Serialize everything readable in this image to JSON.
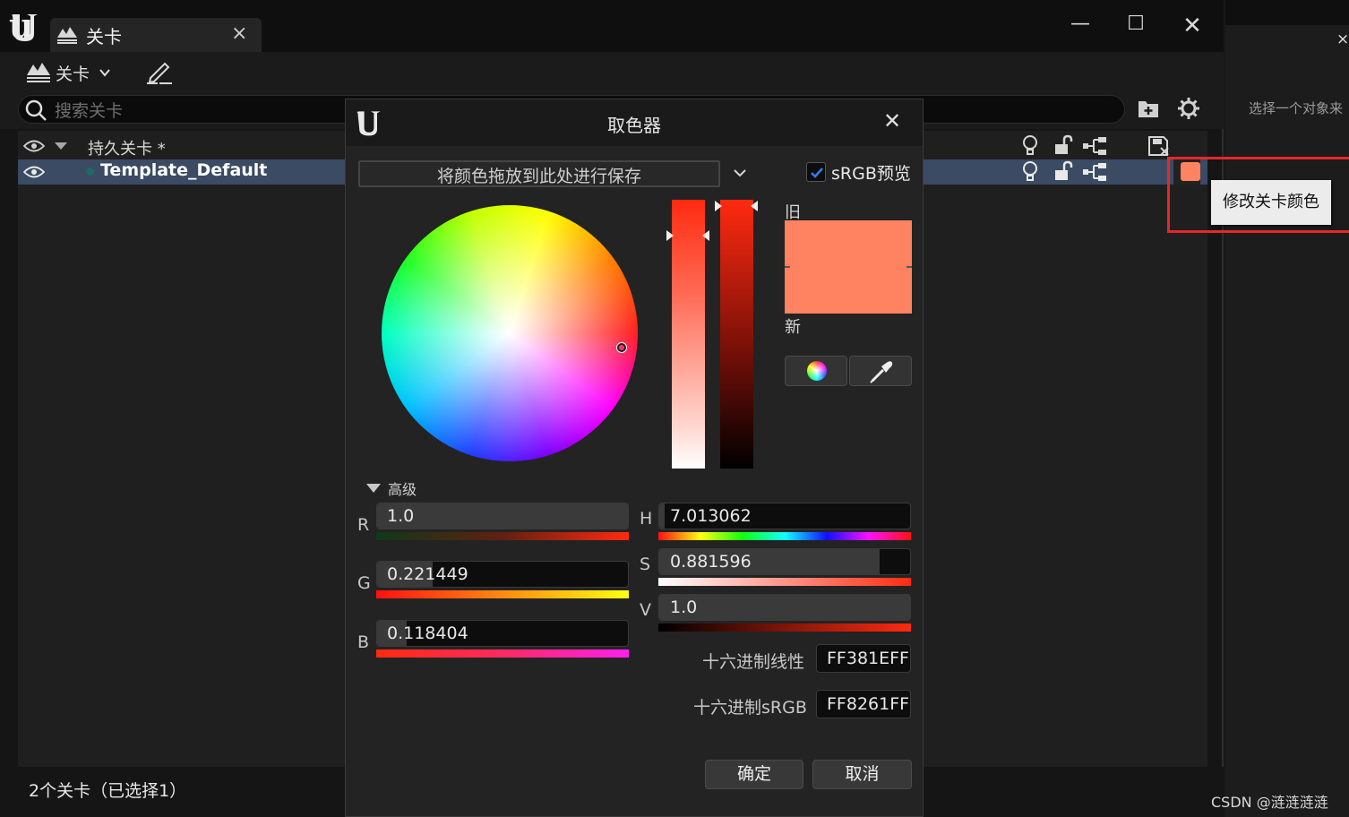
{
  "window": {
    "tab_label": "关卡",
    "tab_close": "×",
    "minimize": "—",
    "maximize": "☐",
    "close": "✕"
  },
  "toolbar": {
    "levels_menu_label": "关卡"
  },
  "search": {
    "placeholder": "搜索关卡"
  },
  "levels": {
    "persistent": {
      "label": "持久关卡 *"
    },
    "selected": {
      "label": "Template_Default"
    }
  },
  "status": {
    "text": "2个关卡（已选择1）"
  },
  "right_panel": {
    "hint": "选择一个对象来",
    "close": "×"
  },
  "tooltip": {
    "text": "修改关卡颜色"
  },
  "color_picker": {
    "title": "取色器",
    "close": "✕",
    "save_drop_text": "将颜色拖放到此处进行保存",
    "srgb_label": "sRGB预览",
    "srgb_checked": true,
    "old_label": "旧",
    "new_label": "新",
    "advanced_label": "高级",
    "r": {
      "label": "R",
      "value": "1.0",
      "fraction": 1.0
    },
    "g": {
      "label": "G",
      "value": "0.221449",
      "fraction": 0.221449
    },
    "b": {
      "label": "B",
      "value": "0.118404",
      "fraction": 0.118404
    },
    "h": {
      "label": "H",
      "value": "7.013062",
      "fraction": 0.019
    },
    "s": {
      "label": "S",
      "value": "0.881596",
      "fraction": 0.881596
    },
    "v": {
      "label": "V",
      "value": "1.0",
      "fraction": 1.0
    },
    "hex_linear": {
      "label": "十六进制线性",
      "value": "FF381EFF"
    },
    "hex_srgb": {
      "label": "十六进制sRGB",
      "value": "FF8261FF"
    },
    "ok_button": "确定",
    "cancel_button": "取消"
  },
  "colors": {
    "level_color": "#ff8261",
    "selection": "#3a4b63",
    "accent_red": "#e8262a"
  },
  "watermark": "CSDN @涟涟涟涟"
}
